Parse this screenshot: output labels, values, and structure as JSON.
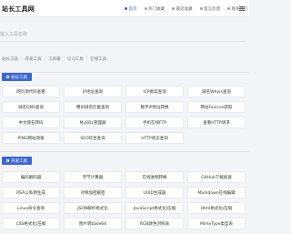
{
  "header": {
    "logo": "站长工具网",
    "nav": [
      {
        "label": "首页",
        "active": true
      },
      {
        "label": "热门收藏",
        "active": false
      },
      {
        "label": "最近收藏",
        "active": false
      },
      {
        "label": "留言反馈",
        "active": false
      },
      {
        "label": "联系我们",
        "active": false
      }
    ]
  },
  "search": {
    "placeholder": "输入工具名称"
  },
  "links": [
    "站长工具",
    "开发工具",
    "工具箱",
    "Q Q工具",
    "在线工具"
  ],
  "sections": [
    {
      "title": "站长工具",
      "tools": [
        "网页源代码查看",
        "IP地址查询",
        "ICP备案查询",
        "域名Whois查询",
        "域名DNS查询",
        "腾讯域名拦截查询",
        "数字IP地址转换",
        "网站Favicon获取",
        "中文域名转码",
        "MySQL管理器",
        "手机在线FTP",
        "查看HTTP请求",
        "PING网站测速",
        "SEO综合查询",
        "HTTP状态查询"
      ]
    },
    {
      "title": "开发工具",
      "tools": [
        "编码解码器",
        "字节计算器",
        "在线进制转换",
        "GitHub下载加速",
        "RSA公私钥生成",
        "对称加密解密",
        "UUID生成器",
        "Markdown在线编辑",
        "Linux命令查询",
        "JSON解析格式化",
        "JavaScript格式化/压缩",
        "Html格式化/压缩",
        "CSS格式化/压缩",
        "图片转base64",
        "RGB颜色对照表",
        "MimeType类型表"
      ]
    }
  ],
  "colors": {
    "accent": "#3a66d8",
    "background": "#f3f4f7"
  }
}
